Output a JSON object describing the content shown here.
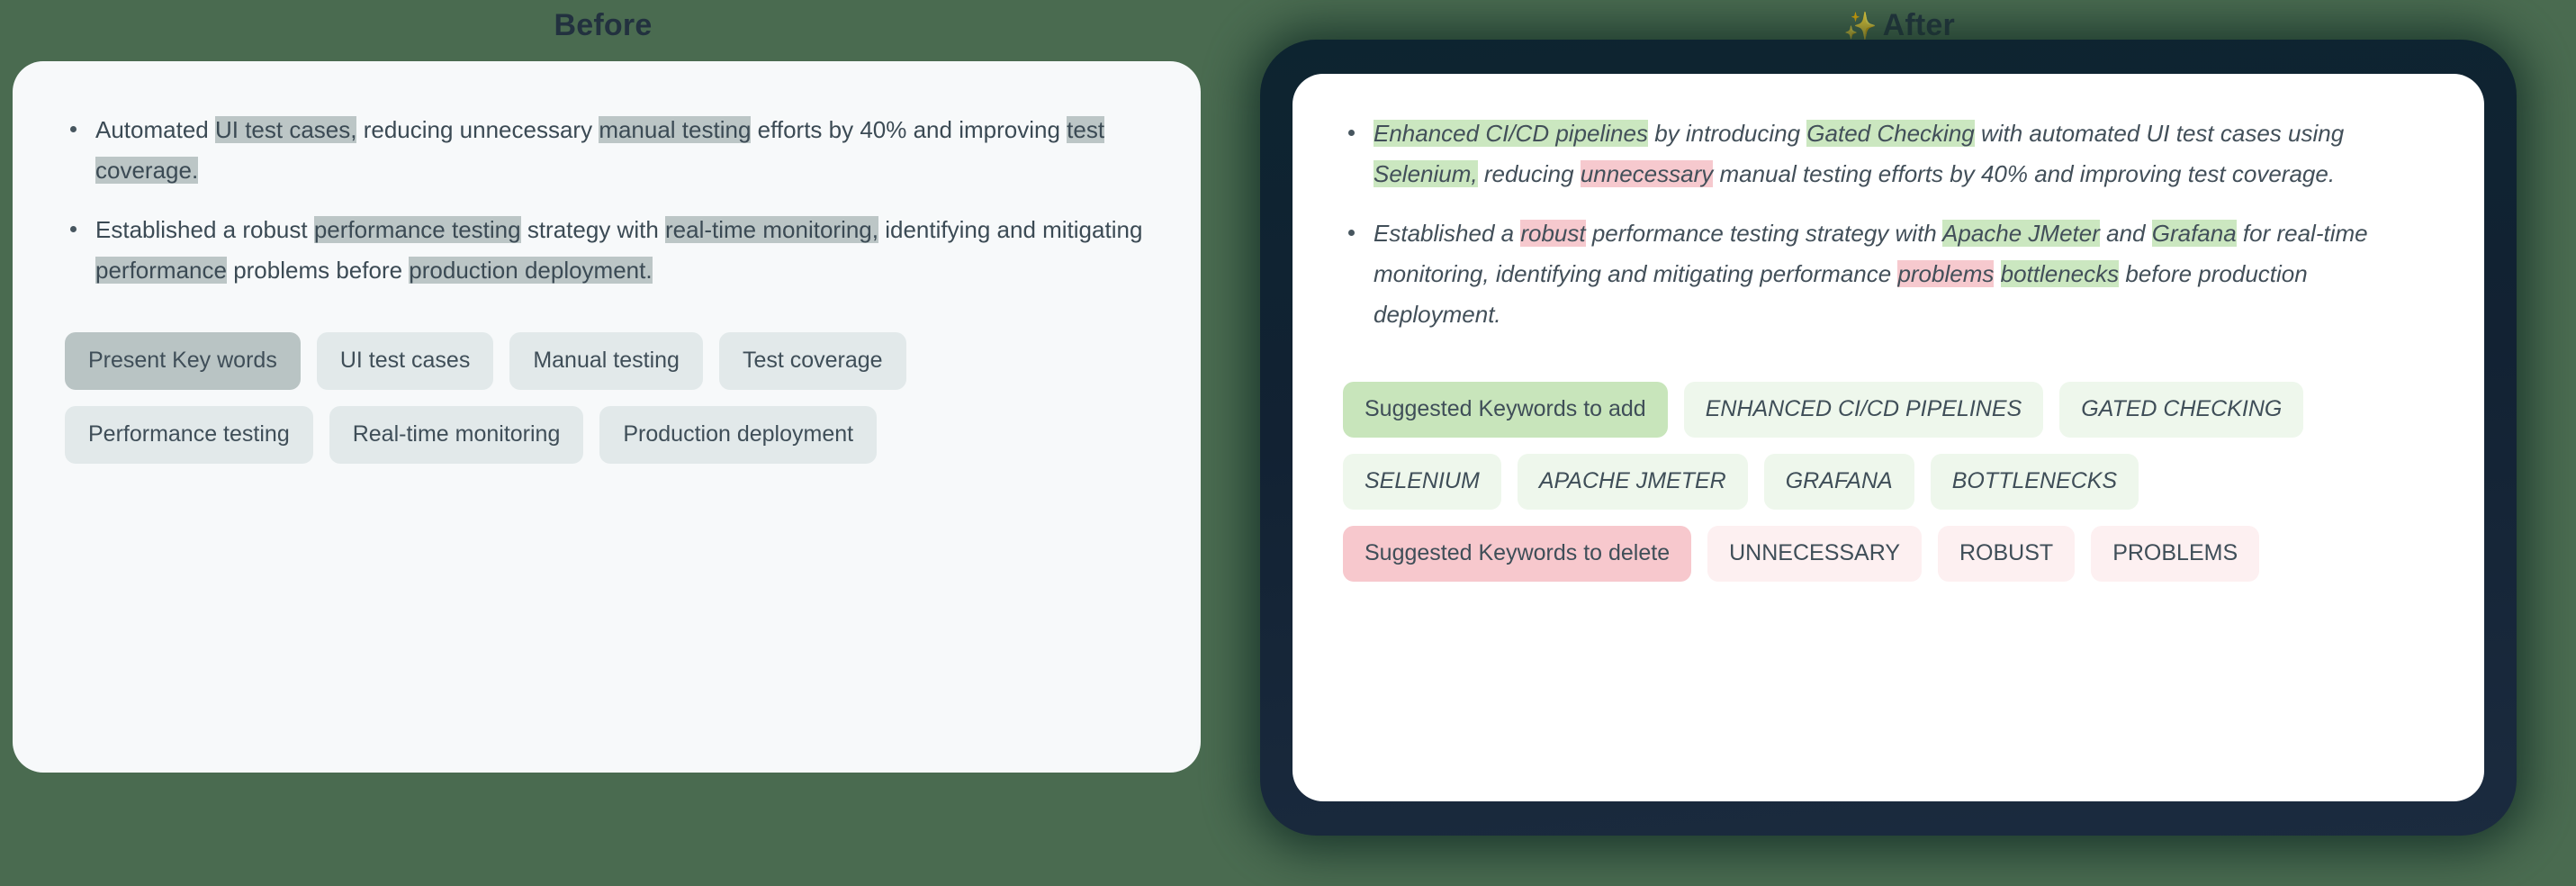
{
  "columns": {
    "before": {
      "heading": "Before",
      "bullets": [
        {
          "segments": [
            {
              "text": "Automated ",
              "style": "plain"
            },
            {
              "text": "UI test cases,",
              "style": "grey"
            },
            {
              "text": " reducing unnecessary ",
              "style": "plain"
            },
            {
              "text": "manual testing",
              "style": "grey"
            },
            {
              "text": " efforts by 40% and improving ",
              "style": "plain"
            },
            {
              "text": "test coverage.",
              "style": "grey"
            }
          ]
        },
        {
          "segments": [
            {
              "text": "Established a robust ",
              "style": "plain"
            },
            {
              "text": "performance testing",
              "style": "grey"
            },
            {
              "text": " strategy with ",
              "style": "plain"
            },
            {
              "text": "real-time monitoring,",
              "style": "grey"
            },
            {
              "text": " identifying and mitigating ",
              "style": "plain"
            },
            {
              "text": "performance",
              "style": "grey"
            },
            {
              "text": " problems before ",
              "style": "plain"
            },
            {
              "text": "production deployment.",
              "style": "grey"
            }
          ]
        }
      ],
      "chip_rows": [
        [
          {
            "label": "Present Key words",
            "style": "grey-strong"
          },
          {
            "label": "UI test cases",
            "style": "grey"
          },
          {
            "label": "Manual testing",
            "style": "grey"
          },
          {
            "label": "Test coverage",
            "style": "grey"
          }
        ],
        [
          {
            "label": "Performance testing",
            "style": "grey"
          },
          {
            "label": "Real-time monitoring",
            "style": "grey"
          },
          {
            "label": "Production deployment",
            "style": "grey"
          }
        ]
      ]
    },
    "after": {
      "heading": "After",
      "sparkle_icon": "✨",
      "bullets": [
        {
          "segments": [
            {
              "text": "Enhanced CI/CD pipelines",
              "style": "green"
            },
            {
              "text": " by introducing ",
              "style": "plain"
            },
            {
              "text": "Gated Checking",
              "style": "green"
            },
            {
              "text": " with automated UI test cases using ",
              "style": "plain"
            },
            {
              "text": "Selenium,",
              "style": "green"
            },
            {
              "text": " reducing ",
              "style": "plain"
            },
            {
              "text": "unnecessary",
              "style": "red"
            },
            {
              "text": " manual testing efforts by 40% and improving test coverage.",
              "style": "plain"
            }
          ]
        },
        {
          "segments": [
            {
              "text": "Established a ",
              "style": "plain"
            },
            {
              "text": "robust",
              "style": "red"
            },
            {
              "text": " performance testing strategy with ",
              "style": "plain"
            },
            {
              "text": "Apache JMeter",
              "style": "green"
            },
            {
              "text": " and ",
              "style": "plain"
            },
            {
              "text": "Grafana",
              "style": "green"
            },
            {
              "text": " for real-time monitoring, identifying and mitigating performance ",
              "style": "plain"
            },
            {
              "text": "problems",
              "style": "red"
            },
            {
              "text": " ",
              "style": "plain"
            },
            {
              "text": "bottlenecks",
              "style": "green"
            },
            {
              "text": " before production deployment.",
              "style": "plain"
            }
          ]
        }
      ],
      "chip_rows": [
        [
          {
            "label": "Suggested Keywords to add",
            "style": "green-strong"
          },
          {
            "label": "ENHANCED CI/CD PIPELINES",
            "style": "green"
          },
          {
            "label": "GATED CHECKING",
            "style": "green"
          }
        ],
        [
          {
            "label": "SELENIUM",
            "style": "green"
          },
          {
            "label": "APACHE JMETER",
            "style": "green"
          },
          {
            "label": "GRAFANA",
            "style": "green"
          },
          {
            "label": "BOTTLENECKS",
            "style": "green"
          }
        ],
        [
          {
            "label": "Suggested Keywords to delete",
            "style": "red-strong"
          },
          {
            "label": "UNNECESSARY",
            "style": "red"
          },
          {
            "label": "ROBUST",
            "style": "red"
          },
          {
            "label": "PROBLEMS",
            "style": "red"
          }
        ]
      ]
    }
  },
  "colors": {
    "page_background": "#4a6b50",
    "before_card": "#f7f9fa",
    "after_frame": "#122233",
    "after_card": "#ffffff",
    "heading_text": "#22313f",
    "highlight_grey": "#bcc6c6",
    "highlight_green": "#cbe7c0",
    "highlight_red": "#f6c9ce"
  }
}
